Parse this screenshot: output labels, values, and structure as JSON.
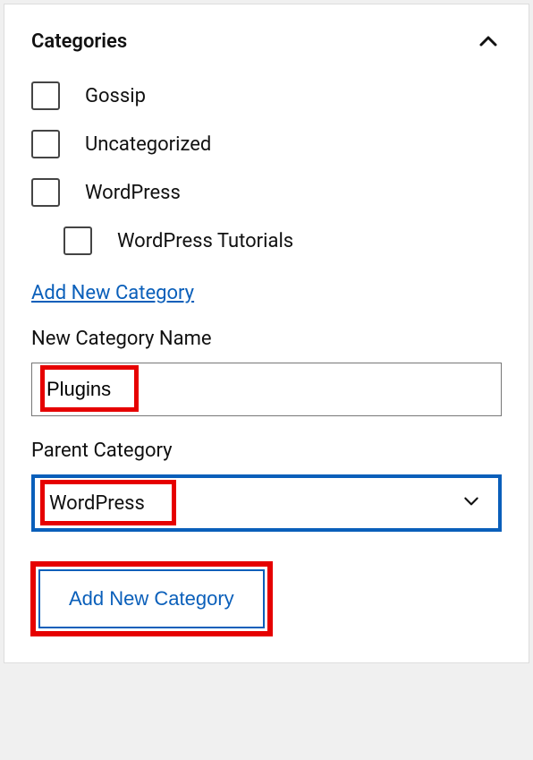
{
  "panel": {
    "title": "Categories"
  },
  "categories": {
    "items": [
      {
        "label": "Gossip"
      },
      {
        "label": "Uncategorized"
      },
      {
        "label": "WordPress"
      },
      {
        "label": "WordPress Tutorials"
      }
    ]
  },
  "addNewLink": "Add New Category",
  "newCategory": {
    "nameLabel": "New Category Name",
    "nameValue": "Plugins",
    "parentLabel": "Parent Category",
    "parentValue": "WordPress",
    "submitLabel": "Add New Category"
  }
}
